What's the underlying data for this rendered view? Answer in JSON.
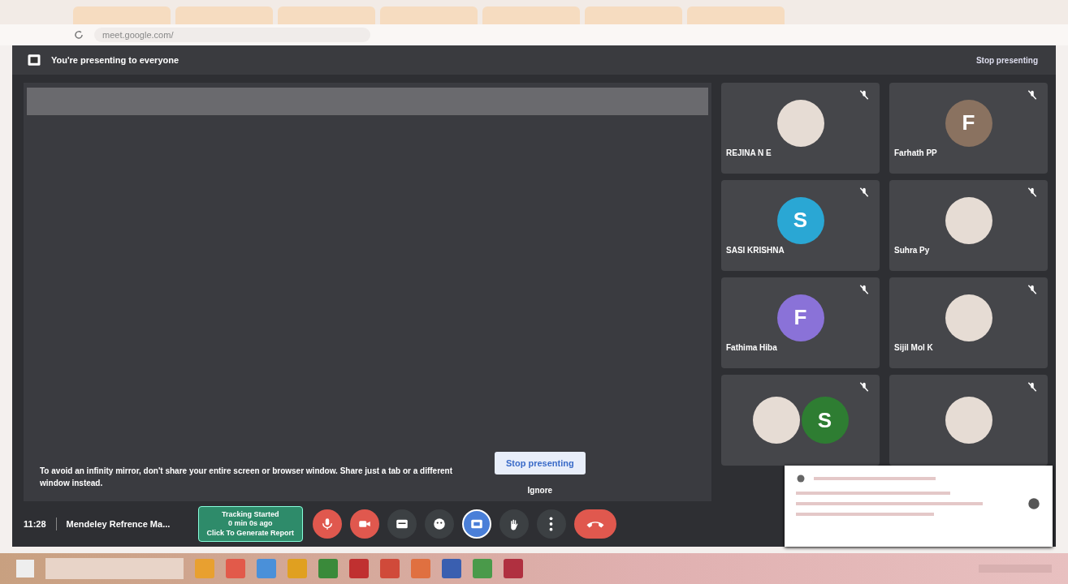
{
  "browser": {
    "url": "meet.google.com/"
  },
  "banner": {
    "text": "You're presenting to everyone",
    "button": "Stop presenting"
  },
  "warning": {
    "text": "To avoid an infinity mirror, don't share your entire screen or browser window. Share just a tab or a different window instead.",
    "primary": "Stop presenting",
    "secondary": "Ignore"
  },
  "tiles": [
    {
      "name": "REJINA N E",
      "avatars": [
        {
          "kind": "photo"
        }
      ]
    },
    {
      "name": "Farhath PP",
      "avatars": [
        {
          "kind": "letter",
          "letter": "F",
          "color": "#8a7260"
        }
      ]
    },
    {
      "name": "SASI KRISHNA",
      "avatars": [
        {
          "kind": "letter",
          "letter": "S",
          "color": "#2aa7d4"
        }
      ]
    },
    {
      "name": "Suhra Py",
      "avatars": [
        {
          "kind": "photo"
        }
      ]
    },
    {
      "name": "Fathima Hiba",
      "avatars": [
        {
          "kind": "letter",
          "letter": "F",
          "color": "#8a72d8"
        }
      ]
    },
    {
      "name": "Sijil Mol K",
      "avatars": [
        {
          "kind": "photo"
        }
      ]
    },
    {
      "avatars": [
        {
          "kind": "photo"
        },
        {
          "kind": "letter",
          "letter": "S",
          "color": "#2e7d32"
        }
      ]
    },
    {
      "avatars": [
        {
          "kind": "photo"
        }
      ]
    }
  ],
  "bottom": {
    "time": "11:28",
    "meeting": "Mendeley Refrence Ma...",
    "extension": [
      "Tracking Started",
      "0 min 0s ago",
      "Click To Generate Report"
    ],
    "controls": [
      {
        "kind": "mic",
        "off": true
      },
      {
        "kind": "camera",
        "off": true
      },
      {
        "kind": "captions",
        "off": false
      },
      {
        "kind": "emoji",
        "off": false
      },
      {
        "kind": "present",
        "selected": true
      },
      {
        "kind": "hand",
        "off": false
      },
      {
        "kind": "more",
        "off": false
      },
      {
        "kind": "hangup"
      }
    ]
  },
  "taskbar": {
    "apps": [
      {
        "color": "#e8a030"
      },
      {
        "color": "#e25a4a"
      },
      {
        "color": "#4a90d9"
      },
      {
        "color": "#e0a020"
      },
      {
        "color": "#3a8a3a"
      },
      {
        "color": "#c03030"
      },
      {
        "color": "#d04a3a"
      },
      {
        "color": "#e07040"
      },
      {
        "color": "#3a5fb0"
      },
      {
        "color": "#4a9a4a"
      },
      {
        "color": "#b03040"
      }
    ]
  }
}
